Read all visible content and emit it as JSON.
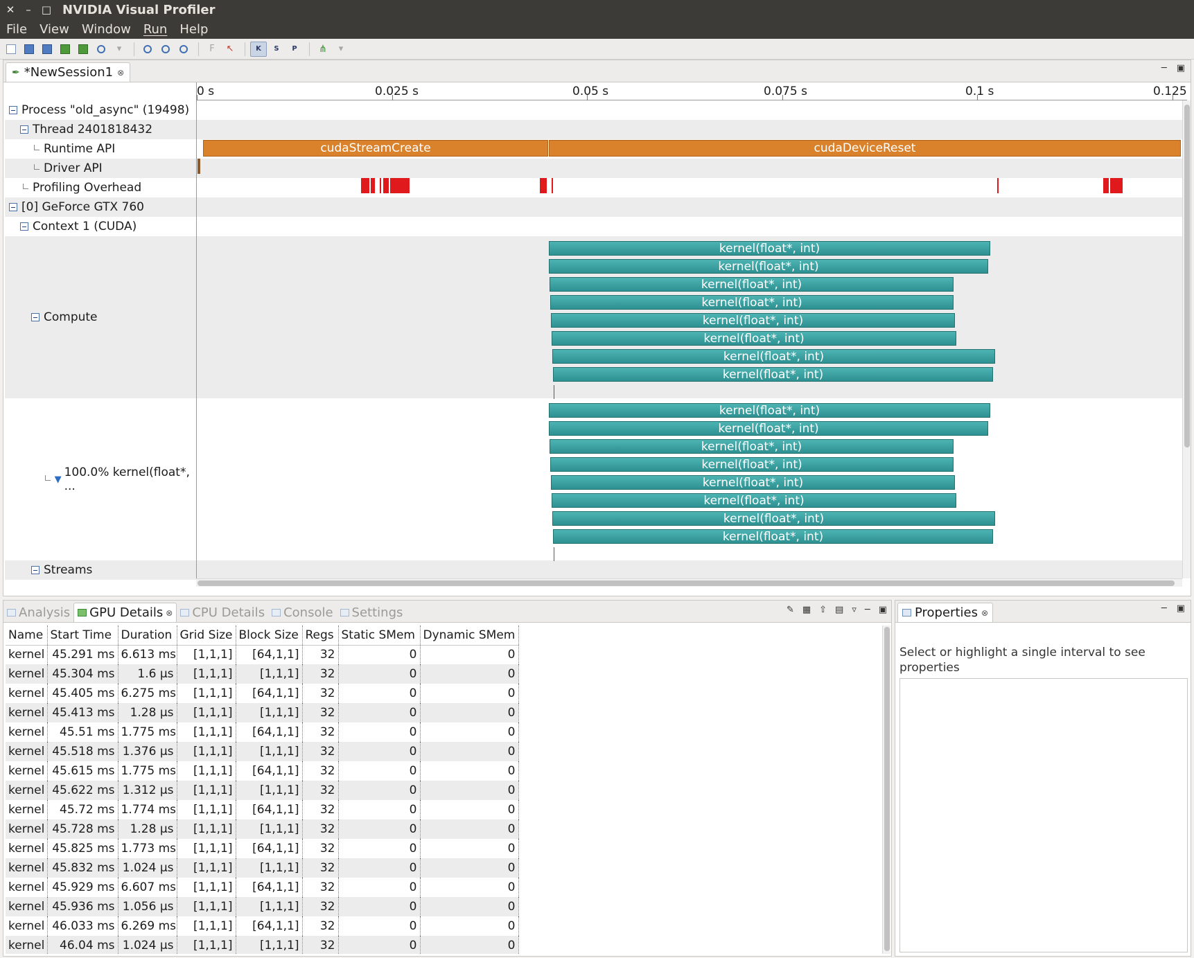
{
  "window": {
    "title": "NVIDIA Visual Profiler",
    "controls": [
      "✕",
      "–",
      "□"
    ]
  },
  "menu": [
    "File",
    "View",
    "Window",
    "Run",
    "Help"
  ],
  "editor": {
    "tab_label": "*NewSession1",
    "ruler_ticks": [
      "0 s",
      "0.025 s",
      "0.05 s",
      "0.075 s",
      "0.1 s",
      "0.125"
    ],
    "rows": {
      "process": "Process \"old_async\" (19498)",
      "thread": "Thread 2401818432",
      "runtime_api": "Runtime API",
      "driver_api": "Driver API",
      "profiling_overhead": "Profiling Overhead",
      "device": "[0] GeForce GTX 760",
      "context": "Context 1 (CUDA)",
      "compute": "Compute",
      "kernel_group": "100.0% kernel(float*, ...",
      "streams": "Streams"
    },
    "runtime_bars": [
      "cudaStreamCreate",
      "cudaDeviceReset"
    ],
    "kernel_label": "kernel(float*, int)"
  },
  "details_tabs": [
    "Analysis",
    "GPU Details",
    "CPU Details",
    "Console",
    "Settings"
  ],
  "gpu_details": {
    "columns": [
      "Name",
      "Start Time",
      "Duration",
      "Grid Size",
      "Block Size",
      "Regs",
      "Static SMem",
      "Dynamic SMem"
    ],
    "rows": [
      [
        "kernel",
        "45.291 ms",
        "6.613 ms",
        "[1,1,1]",
        "[64,1,1]",
        "32",
        "0",
        "0"
      ],
      [
        "kernel",
        "45.304 ms",
        "1.6 μs",
        "[1,1,1]",
        "[1,1,1]",
        "32",
        "0",
        "0"
      ],
      [
        "kernel",
        "45.405 ms",
        "6.275 ms",
        "[1,1,1]",
        "[64,1,1]",
        "32",
        "0",
        "0"
      ],
      [
        "kernel",
        "45.413 ms",
        "1.28 μs",
        "[1,1,1]",
        "[1,1,1]",
        "32",
        "0",
        "0"
      ],
      [
        "kernel",
        "45.51 ms",
        "1.775 ms",
        "[1,1,1]",
        "[64,1,1]",
        "32",
        "0",
        "0"
      ],
      [
        "kernel",
        "45.518 ms",
        "1.376 μs",
        "[1,1,1]",
        "[1,1,1]",
        "32",
        "0",
        "0"
      ],
      [
        "kernel",
        "45.615 ms",
        "1.775 ms",
        "[1,1,1]",
        "[64,1,1]",
        "32",
        "0",
        "0"
      ],
      [
        "kernel",
        "45.622 ms",
        "1.312 μs",
        "[1,1,1]",
        "[1,1,1]",
        "32",
        "0",
        "0"
      ],
      [
        "kernel",
        "45.72 ms",
        "1.774 ms",
        "[1,1,1]",
        "[64,1,1]",
        "32",
        "0",
        "0"
      ],
      [
        "kernel",
        "45.728 ms",
        "1.28 μs",
        "[1,1,1]",
        "[1,1,1]",
        "32",
        "0",
        "0"
      ],
      [
        "kernel",
        "45.825 ms",
        "1.773 ms",
        "[1,1,1]",
        "[64,1,1]",
        "32",
        "0",
        "0"
      ],
      [
        "kernel",
        "45.832 ms",
        "1.024 μs",
        "[1,1,1]",
        "[1,1,1]",
        "32",
        "0",
        "0"
      ],
      [
        "kernel",
        "45.929 ms",
        "6.607 ms",
        "[1,1,1]",
        "[64,1,1]",
        "32",
        "0",
        "0"
      ],
      [
        "kernel",
        "45.936 ms",
        "1.056 μs",
        "[1,1,1]",
        "[1,1,1]",
        "32",
        "0",
        "0"
      ],
      [
        "kernel",
        "46.033 ms",
        "6.269 ms",
        "[1,1,1]",
        "[64,1,1]",
        "32",
        "0",
        "0"
      ],
      [
        "kernel",
        "46.04 ms",
        "1.024 μs",
        "[1,1,1]",
        "[1,1,1]",
        "32",
        "0",
        "0"
      ]
    ]
  },
  "properties": {
    "tab_label": "Properties",
    "message": "Select or highlight a single interval to see properties"
  }
}
